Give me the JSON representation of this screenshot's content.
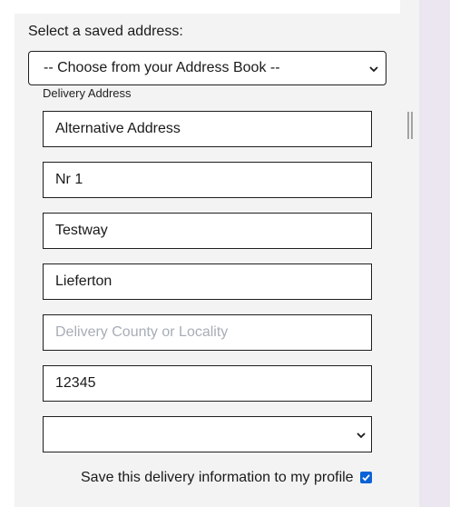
{
  "saved_address": {
    "label": "Select a saved address:",
    "selected": "-- Choose from your Address Book --"
  },
  "delivery": {
    "section_label": "Delivery Address",
    "fields": [
      {
        "value": "Alternative Address",
        "placeholder": ""
      },
      {
        "value": "Nr 1",
        "placeholder": ""
      },
      {
        "value": "Testway",
        "placeholder": ""
      },
      {
        "value": "Lieferton",
        "placeholder": ""
      },
      {
        "value": "",
        "placeholder": "Delivery County or Locality"
      },
      {
        "value": "12345",
        "placeholder": ""
      }
    ],
    "country_selected": ""
  },
  "save_option": {
    "label": "Save this delivery information to my profile",
    "checked": true
  },
  "icons": {
    "select_arrow": "chevron-down-icon",
    "checkmark": "checkmark-icon",
    "scroll_handle": "resize-handle-icon"
  },
  "colors": {
    "checkbox_accent": "#0b62d6",
    "placeholder_text": "#a7adb6",
    "panel_background": "#f3f3f3",
    "page_background": "#ece6f1"
  }
}
